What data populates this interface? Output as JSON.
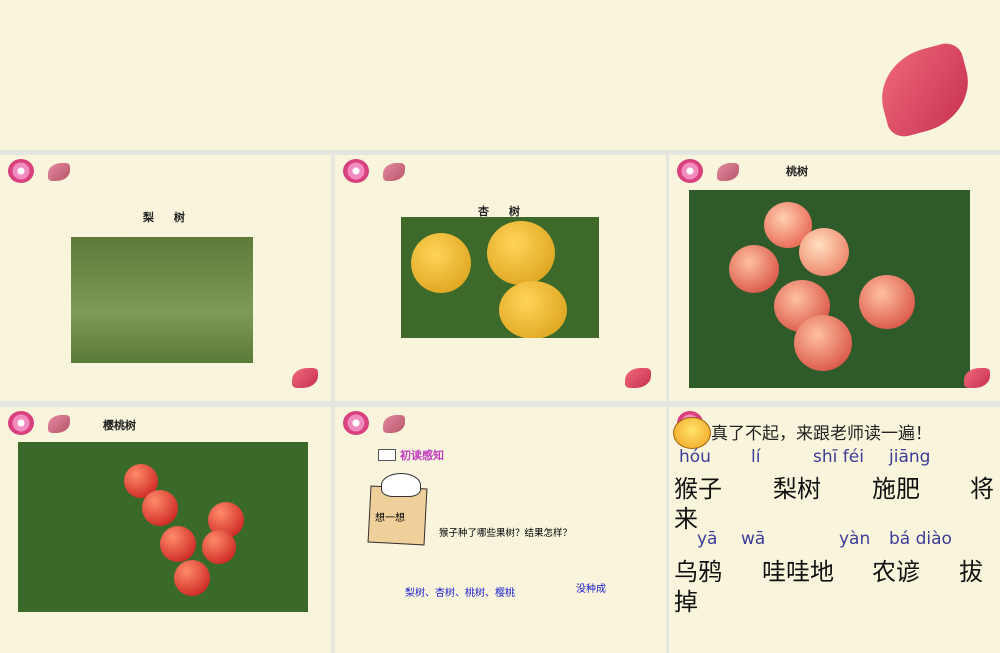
{
  "slides": [
    {
      "title": "梨 树"
    },
    {
      "title": "杏 树"
    },
    {
      "title": "桃树"
    },
    {
      "title": "樱桃树"
    },
    {
      "section": "初读感知",
      "think": "想一想",
      "question": "猴子种了哪些果树？结果怎样？",
      "answer1": "梨树、杏树、桃树、樱桃",
      "answer2": "没种成"
    },
    {
      "prompt": "真了不起，来跟老师读一遍！",
      "pinyin1": [
        "hóu",
        "lí",
        "shī féi",
        "jiāng"
      ],
      "words1": [
        "猴子",
        "梨树",
        "施肥",
        "将"
      ],
      "wrap1": "来",
      "pinyin2": [
        "yā",
        "wā",
        "yàn",
        "bá diào"
      ],
      "words2": [
        "乌鸦",
        "哇哇地",
        "农谚",
        "拔"
      ],
      "wrap2": "掉"
    }
  ]
}
